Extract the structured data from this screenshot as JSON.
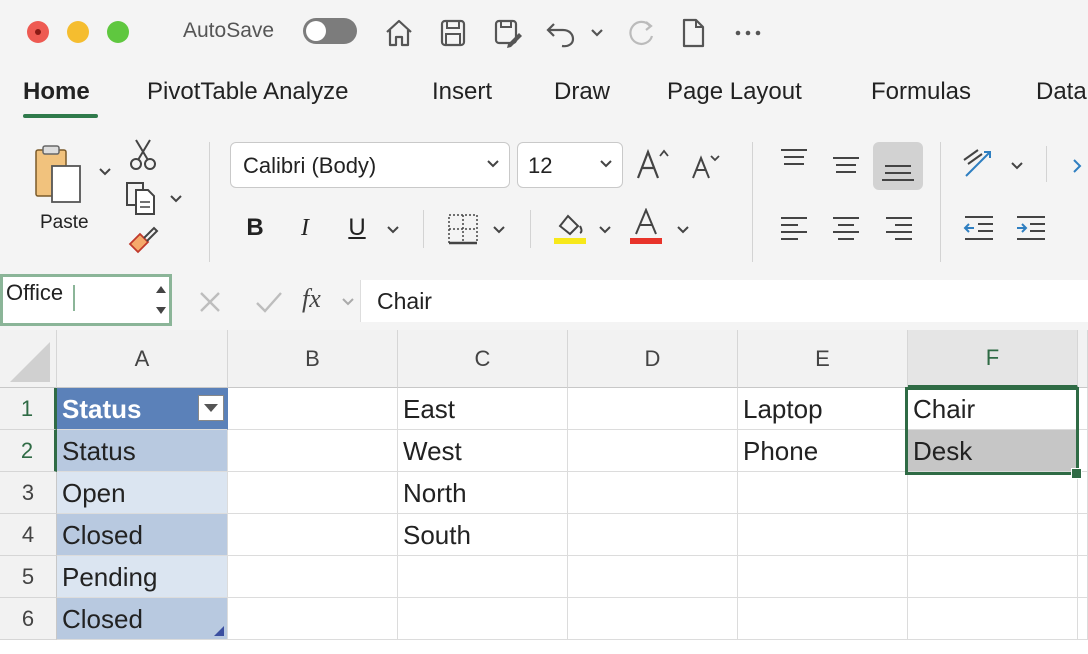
{
  "titlebar": {
    "autosave_label": "AutoSave"
  },
  "tabs": [
    {
      "label": "Home"
    },
    {
      "label": "PivotTable Analyze"
    },
    {
      "label": "Insert"
    },
    {
      "label": "Draw"
    },
    {
      "label": "Page Layout"
    },
    {
      "label": "Formulas"
    },
    {
      "label": "Data"
    }
  ],
  "ribbon": {
    "paste_label": "Paste",
    "font_name": "Calibri (Body)",
    "font_size": "12",
    "bold_label": "B",
    "italic_label": "I",
    "underline_label": "U"
  },
  "formula_bar": {
    "name_box": "Office",
    "fx_label": "fx",
    "content": "Chair"
  },
  "grid": {
    "columns": [
      "A",
      "B",
      "C",
      "D",
      "E",
      "F"
    ],
    "rows": [
      "1",
      "2",
      "3",
      "4",
      "5",
      "6"
    ],
    "cells": {
      "A1": "Status",
      "A2": "Status",
      "A3": "Open",
      "A4": "Closed",
      "A5": "Pending",
      "A6": "Closed",
      "C1": "East",
      "C2": "West",
      "C3": "North",
      "C4": "South",
      "E1": "Laptop",
      "E2": "Phone",
      "F1": "Chair",
      "F2": "Desk"
    }
  },
  "colors": {
    "accent": "#2f6b45",
    "table_header": "#5b81b9",
    "band_dark": "#b8c9e0",
    "band_light": "#dbe5f1",
    "font_color_bar": "#e8332a",
    "highlight_bar": "#f7e81a"
  }
}
